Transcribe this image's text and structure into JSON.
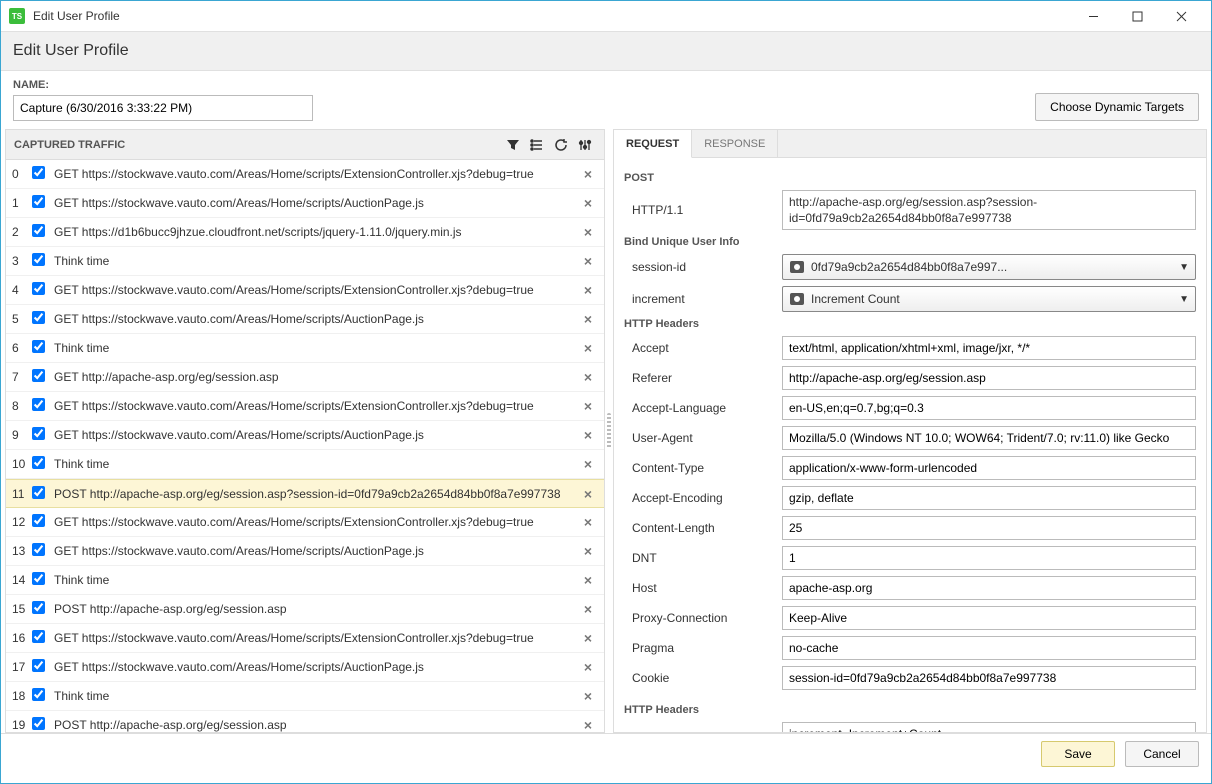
{
  "window": {
    "title": "Edit User Profile"
  },
  "subheader": "Edit User Profile",
  "name": {
    "label": "NAME:",
    "value": "Capture (6/30/2016 3:33:22 PM)"
  },
  "dynamic_targets_label": "Choose Dynamic Targets",
  "captured_traffic_header": "CAPTURED TRAFFIC",
  "traffic": [
    {
      "idx": "0",
      "text": "GET https://stockwave.vauto.com/Areas/Home/scripts/ExtensionController.xjs?debug=true"
    },
    {
      "idx": "1",
      "text": "GET https://stockwave.vauto.com/Areas/Home/scripts/AuctionPage.js"
    },
    {
      "idx": "2",
      "text": "GET https://d1b6bucc9jhzue.cloudfront.net/scripts/jquery-1.11.0/jquery.min.js"
    },
    {
      "idx": "3",
      "text": "Think time"
    },
    {
      "idx": "4",
      "text": "GET https://stockwave.vauto.com/Areas/Home/scripts/ExtensionController.xjs?debug=true"
    },
    {
      "idx": "5",
      "text": "GET https://stockwave.vauto.com/Areas/Home/scripts/AuctionPage.js"
    },
    {
      "idx": "6",
      "text": "Think time"
    },
    {
      "idx": "7",
      "text": "GET http://apache-asp.org/eg/session.asp"
    },
    {
      "idx": "8",
      "text": "GET https://stockwave.vauto.com/Areas/Home/scripts/ExtensionController.xjs?debug=true"
    },
    {
      "idx": "9",
      "text": "GET https://stockwave.vauto.com/Areas/Home/scripts/AuctionPage.js"
    },
    {
      "idx": "10",
      "text": "Think time"
    },
    {
      "idx": "11",
      "text": "POST http://apache-asp.org/eg/session.asp?session-id=0fd79a9cb2a2654d84bb0f8a7e997738",
      "selected": true
    },
    {
      "idx": "12",
      "text": "GET https://stockwave.vauto.com/Areas/Home/scripts/ExtensionController.xjs?debug=true"
    },
    {
      "idx": "13",
      "text": "GET https://stockwave.vauto.com/Areas/Home/scripts/AuctionPage.js"
    },
    {
      "idx": "14",
      "text": "Think time"
    },
    {
      "idx": "15",
      "text": "POST http://apache-asp.org/eg/session.asp"
    },
    {
      "idx": "16",
      "text": "GET https://stockwave.vauto.com/Areas/Home/scripts/ExtensionController.xjs?debug=true"
    },
    {
      "idx": "17",
      "text": "GET https://stockwave.vauto.com/Areas/Home/scripts/AuctionPage.js"
    },
    {
      "idx": "18",
      "text": "Think time"
    },
    {
      "idx": "19",
      "text": "POST http://apache-asp.org/eg/session.asp"
    }
  ],
  "tabs": {
    "request": "REQUEST",
    "response": "RESPONSE"
  },
  "detail": {
    "method": "POST",
    "version_label": "HTTP/1.1",
    "url": "http://apache-asp.org/eg/session.asp?session-id=0fd79a9cb2a2654d84bb0f8a7e997738",
    "bind_section": "Bind Unique User Info",
    "session_id_label": "session-id",
    "session_id_value": "0fd79a9cb2a2654d84bb0f8a7e997...",
    "increment_label": "increment",
    "increment_value": "Increment Count",
    "headers_section": "HTTP Headers",
    "headers": [
      {
        "k": "Accept",
        "v": "text/html, application/xhtml+xml, image/jxr, */*"
      },
      {
        "k": "Referer",
        "v": "http://apache-asp.org/eg/session.asp"
      },
      {
        "k": "Accept-Language",
        "v": "en-US,en;q=0.7,bg;q=0.3"
      },
      {
        "k": "User-Agent",
        "v": "Mozilla/5.0 (Windows NT 10.0; WOW64; Trident/7.0; rv:11.0) like Gecko"
      },
      {
        "k": "Content-Type",
        "v": "application/x-www-form-urlencoded"
      },
      {
        "k": "Accept-Encoding",
        "v": "gzip, deflate"
      },
      {
        "k": "Content-Length",
        "v": "25"
      },
      {
        "k": "DNT",
        "v": "1"
      },
      {
        "k": "Host",
        "v": "apache-asp.org"
      },
      {
        "k": "Proxy-Connection",
        "v": "Keep-Alive"
      },
      {
        "k": "Pragma",
        "v": "no-cache"
      },
      {
        "k": "Cookie",
        "v": "session-id=0fd79a9cb2a2654d84bb0f8a7e997738"
      }
    ],
    "body_section": "HTTP Headers",
    "body_value": "increment=Increment+Count"
  },
  "footer": {
    "save": "Save",
    "cancel": "Cancel"
  }
}
